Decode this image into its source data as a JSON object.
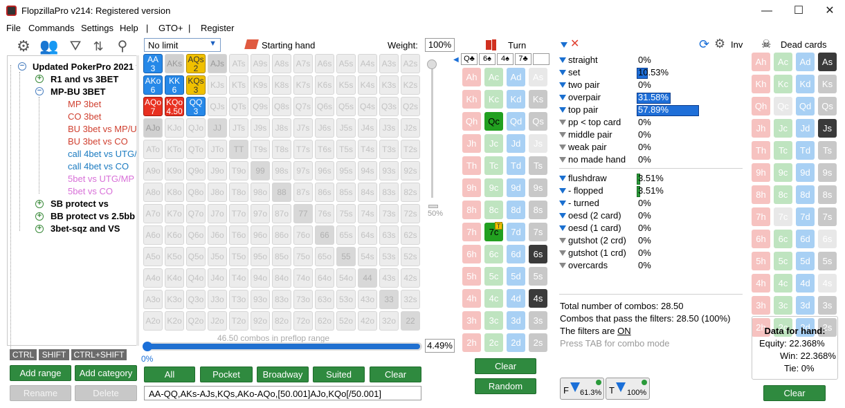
{
  "window": {
    "title": "FlopzillaPro v214: Registered version",
    "min": "—",
    "max": "☐",
    "close": "✕"
  },
  "menu": {
    "file": "File",
    "commands": "Commands",
    "settings": "Settings",
    "help": "Help",
    "sep1": "|",
    "gtoplus": "GTO+",
    "sep2": "|",
    "register": "Register"
  },
  "tree": {
    "root": "Updated PokerPro 2021 v",
    "r1": "R1 and vs 3BET",
    "mpbu": "MP-BU 3BET",
    "mp3": "MP 3bet",
    "co3": "CO 3bet",
    "bu3mp": "BU 3bet vs MP/U",
    "bu3co": "BU 3bet vs CO",
    "call4utg": "call 4bet vs UTG/",
    "call4co": "call 4bet vs CO",
    "b5utg": "5bet vs UTG/MP",
    "b5co": "5bet vs CO",
    "sb": "SB protect vs",
    "bb": "BB protect vs 2.5bb",
    "sqz": "3bet-sqz and VS"
  },
  "keys": {
    "ctrl": "CTRL",
    "shift": "SHIFT",
    "ctrlshift": "CTRL+SHIFT"
  },
  "left_buttons": {
    "add_range": "Add range",
    "add_category": "Add category",
    "rename": "Rename",
    "delete": "Delete"
  },
  "range": {
    "limit": "No limit",
    "starting_hand": "Starting hand",
    "weight_label": "Weight:",
    "weight": "100%",
    "slider_pct": "50%",
    "combos_text": "46.50 combos in preflop range",
    "progress_pct": "4.49%",
    "progress_start": "0%",
    "range_text": "AA-QQ,AKs-AJs,KQs,AKo-AQo,[50.001]AJo,KQo[/50.001]"
  },
  "range_buttons": {
    "all": "All",
    "pocket": "Pocket",
    "broadway": "Broadway",
    "suited": "Suited",
    "clear": "Clear"
  },
  "matrix": {
    "rows": [
      [
        "AA",
        "AKs",
        "AQs",
        "AJs",
        "ATs",
        "A9s",
        "A8s",
        "A7s",
        "A6s",
        "A5s",
        "A4s",
        "A3s",
        "A2s"
      ],
      [
        "AKo",
        "KK",
        "KQs",
        "KJs",
        "KTs",
        "K9s",
        "K8s",
        "K7s",
        "K6s",
        "K5s",
        "K4s",
        "K3s",
        "K2s"
      ],
      [
        "AQo",
        "KQo",
        "QQ",
        "QJs",
        "QTs",
        "Q9s",
        "Q8s",
        "Q7s",
        "Q6s",
        "Q5s",
        "Q4s",
        "Q3s",
        "Q2s"
      ],
      [
        "AJo",
        "KJo",
        "QJo",
        "JJ",
        "JTs",
        "J9s",
        "J8s",
        "J7s",
        "J6s",
        "J5s",
        "J4s",
        "J3s",
        "J2s"
      ],
      [
        "ATo",
        "KTo",
        "QTo",
        "JTo",
        "TT",
        "T9s",
        "T8s",
        "T7s",
        "T6s",
        "T5s",
        "T4s",
        "T3s",
        "T2s"
      ],
      [
        "A9o",
        "K9o",
        "Q9o",
        "J9o",
        "T9o",
        "99",
        "98s",
        "97s",
        "96s",
        "95s",
        "94s",
        "93s",
        "92s"
      ],
      [
        "A8o",
        "K8o",
        "Q8o",
        "J8o",
        "T8o",
        "98o",
        "88",
        "87s",
        "86s",
        "85s",
        "84s",
        "83s",
        "82s"
      ],
      [
        "A7o",
        "K7o",
        "Q7o",
        "J7o",
        "T7o",
        "97o",
        "87o",
        "77",
        "76s",
        "75s",
        "74s",
        "73s",
        "72s"
      ],
      [
        "A6o",
        "K6o",
        "Q6o",
        "J6o",
        "T6o",
        "96o",
        "86o",
        "76o",
        "66",
        "65s",
        "64s",
        "63s",
        "62s"
      ],
      [
        "A5o",
        "K5o",
        "Q5o",
        "J5o",
        "T5o",
        "95o",
        "85o",
        "75o",
        "65o",
        "55",
        "54s",
        "53s",
        "52s"
      ],
      [
        "A4o",
        "K4o",
        "Q4o",
        "J4o",
        "T4o",
        "94o",
        "84o",
        "74o",
        "64o",
        "54o",
        "44",
        "43s",
        "42s"
      ],
      [
        "A3o",
        "K3o",
        "Q3o",
        "J3o",
        "T3o",
        "93o",
        "83o",
        "73o",
        "63o",
        "53o",
        "43o",
        "33",
        "32s"
      ],
      [
        "A2o",
        "K2o",
        "Q2o",
        "J2o",
        "T2o",
        "92o",
        "82o",
        "72o",
        "62o",
        "52o",
        "42o",
        "32o",
        "22"
      ]
    ],
    "counts": {
      "AA": "3",
      "AQs": "2",
      "AKo": "6",
      "KK": "6",
      "KQs": "3",
      "AQo": "7",
      "KQo": "4.50",
      "QQ": "3"
    }
  },
  "board": {
    "street": "Turn",
    "clear": "Clear",
    "random": "Random",
    "badge": "T",
    "ranks": [
      "A",
      "K",
      "Q",
      "J",
      "T",
      "9",
      "8",
      "7",
      "6",
      "5",
      "4",
      "3",
      "2"
    ],
    "mini": [
      "Q♣",
      "6♠",
      "4♠",
      "7♣",
      ""
    ]
  },
  "stats": {
    "rows": [
      {
        "label": "straight",
        "pct": "0%",
        "filter": "blue"
      },
      {
        "label": "set",
        "pct": "10.53%",
        "filter": "blue",
        "bar": 10.53
      },
      {
        "label": "two pair",
        "pct": "0%",
        "filter": "blue"
      },
      {
        "label": "overpair",
        "pct": "31.58%",
        "filter": "blue",
        "bar": 31.58
      },
      {
        "label": "top pair",
        "pct": "57.89%",
        "filter": "blue",
        "bar": 57.89
      },
      {
        "label": "pp < top card",
        "pct": "0%",
        "filter": "gray"
      },
      {
        "label": "middle pair",
        "pct": "0%",
        "filter": "gray"
      },
      {
        "label": "weak pair",
        "pct": "0%",
        "filter": "gray"
      },
      {
        "label": "no made hand",
        "pct": "0%",
        "filter": "gray"
      }
    ],
    "draws": [
      {
        "label": "flushdraw",
        "pct": "3.51%",
        "filter": "blue",
        "bar": 3.51
      },
      {
        "label": "- flopped",
        "pct": "3.51%",
        "filter": "blue",
        "bar": 3.51
      },
      {
        "label": "- turned",
        "pct": "0%",
        "filter": "blue"
      },
      {
        "label": "oesd (2 card)",
        "pct": "0%",
        "filter": "blue"
      },
      {
        "label": "oesd (1 card)",
        "pct": "0%",
        "filter": "blue"
      },
      {
        "label": "gutshot (2 crd)",
        "pct": "0%",
        "filter": "gray"
      },
      {
        "label": "gutshot (1 crd)",
        "pct": "0%",
        "filter": "gray"
      },
      {
        "label": "overcards",
        "pct": "0%",
        "filter": "gray"
      }
    ],
    "inv": "Inv",
    "total": "Total number of combos: 28.50",
    "pass": "Combos that pass the filters: 28.50 (100%)",
    "filters_on_prefix": "The filters are ",
    "filters_on": "ON",
    "tab_hint": "Press TAB for combo mode",
    "f_label": "F",
    "f_pct": "61.3%",
    "t_label": "T",
    "t_pct": "100%"
  },
  "dead": {
    "title": "Dead cards",
    "clear": "Clear",
    "data_title": "Data for hand:",
    "equity": "Equity: 22.368%",
    "win": "Win: 22.368%",
    "tie": "Tie: 0%"
  },
  "colors": {
    "accent": "#2688e8",
    "green": "#2f8a3f",
    "hearts": "#f6c2c0",
    "clubs": "#bfe4c0",
    "diamonds": "#a8d0f4",
    "spades": "#c8c8c8"
  }
}
